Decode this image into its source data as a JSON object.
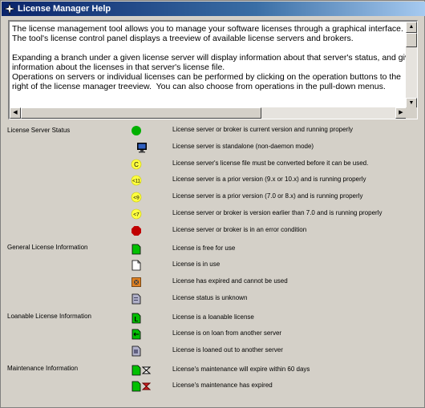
{
  "window": {
    "title": "License Manager Help"
  },
  "help_text": "The license management tool allows you to manage your software licenses through a graphical interface.\nThe tool's license control panel displays a treeview of available license servers and brokers.\n\nExpanding a branch under a given license server will display information about that server's status, and give\ninformation about the licenses in that server's license file.\nOperations on servers or individual licenses can be performed by clicking on the operation buttons to the\nright of the license manager treeview.  You can also choose from operations in the pull-down menus.",
  "sections": {
    "server_status": "License Server Status",
    "general": "General License Information",
    "loanable": "Loanable License Information",
    "maintenance": "Maintenance Information"
  },
  "legend": {
    "server_running": {
      "icon": "green-circle-icon",
      "text": "License server or broker is current version and running properly"
    },
    "server_standalone": {
      "icon": "monitor-icon",
      "text": "License server is standalone (non-daemon mode)"
    },
    "server_convert": {
      "icon": "yellow-c-icon",
      "badge": "C",
      "text": "License server's license file must be converted before it can be used."
    },
    "server_v11": {
      "icon": "yellow-v11-icon",
      "badge": "<11",
      "text": "License server is a prior version (9.x or 10.x) and is running properly"
    },
    "server_v9": {
      "icon": "yellow-v9-icon",
      "badge": "<9",
      "text": "License server is a prior version (7.0 or 8.x) and is running properly"
    },
    "server_v7": {
      "icon": "yellow-v7-icon",
      "badge": "<7",
      "text": "License server or broker is version earlier than 7.0 and is running properly"
    },
    "server_error": {
      "icon": "red-octagon-icon",
      "text": "License server or broker is in an error condition"
    },
    "lic_free": {
      "icon": "green-doc-icon",
      "text": "License is free for use"
    },
    "lic_in_use": {
      "icon": "white-doc-icon",
      "text": "License is in use"
    },
    "lic_expired": {
      "icon": "expired-doc-icon",
      "text": "License has expired and cannot be used"
    },
    "lic_unknown": {
      "icon": "unknown-doc-icon",
      "text": "License status is unknown"
    },
    "loan_loanable": {
      "icon": "loanable-doc-icon",
      "text": "License is a loanable license"
    },
    "loan_on_loan": {
      "icon": "on-loan-doc-icon",
      "text": "License is on loan from another server"
    },
    "loan_out": {
      "icon": "loaned-out-doc-icon",
      "text": "License is loaned out to another server"
    },
    "maint_expiring": {
      "icon": "maint-expiring-icon",
      "text": "License's maintenance will expire within 60 days"
    },
    "maint_expired": {
      "icon": "maint-expired-icon",
      "text": "License's maintenance has expired"
    }
  },
  "colors": {
    "green": "#00b000",
    "yellow": "#ffff40",
    "red": "#c00000",
    "title_blue": "#0a246a"
  }
}
